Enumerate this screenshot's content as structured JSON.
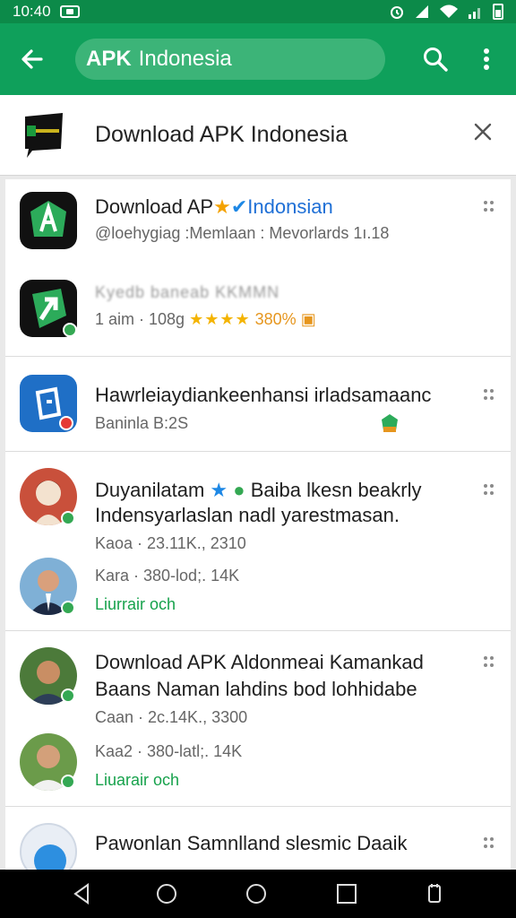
{
  "status_bar": {
    "time": "10:40"
  },
  "app_bar": {
    "search_brand": "APK",
    "search_text": "Indonesia"
  },
  "header": {
    "title": "Download APK Indonesia"
  },
  "rows": [
    {
      "title_prefix": "Download AP",
      "title_suffix": "Indonsian",
      "sub": "@loehygiag :Memlaan : Mevorlards 1ı.18"
    },
    {
      "title_blur": "Kyedb baneab KKMMN",
      "meta": "1 aim · 108g",
      "stars": "★★★★",
      "rating": "380%"
    },
    {
      "title": "Hawrleiaydiankeenhansi irladsamaanc",
      "sub": "Baninla B:2S"
    },
    {
      "title_line1": "Duyanilatam",
      "title_line1_rest": "Baiba lkesn beakrly",
      "title_line2": "Indensyarlaslan nadl yarestmasan.",
      "meta1": "Kaoa · 23.11K., 2310",
      "meta2": "Kara · 380-lod;. 14K",
      "link": "Liurrair och"
    },
    {
      "title_line1": "Download APK Aldonmeai Kamankad",
      "title_line2": "Baans Naman lahdins bod lohhidabe",
      "meta1": "Caan · 2c.14K., 3300",
      "meta2": "Kaa2 · 380-latl;. 14K",
      "link": "Liuarair och"
    },
    {
      "title": "Pawonlan Samnlland slesmic Daaik"
    }
  ],
  "icons": {
    "back": "arrow-left-icon",
    "search": "search-icon",
    "more": "more-vert-icon",
    "close": "close-icon",
    "drag": "drag-handle-icon"
  },
  "colors": {
    "status_bar": "#0c8a49",
    "app_bar": "#0fa05b",
    "search_pill": "#3cb478",
    "link_green": "#17a24c",
    "star": "#f4b400"
  }
}
